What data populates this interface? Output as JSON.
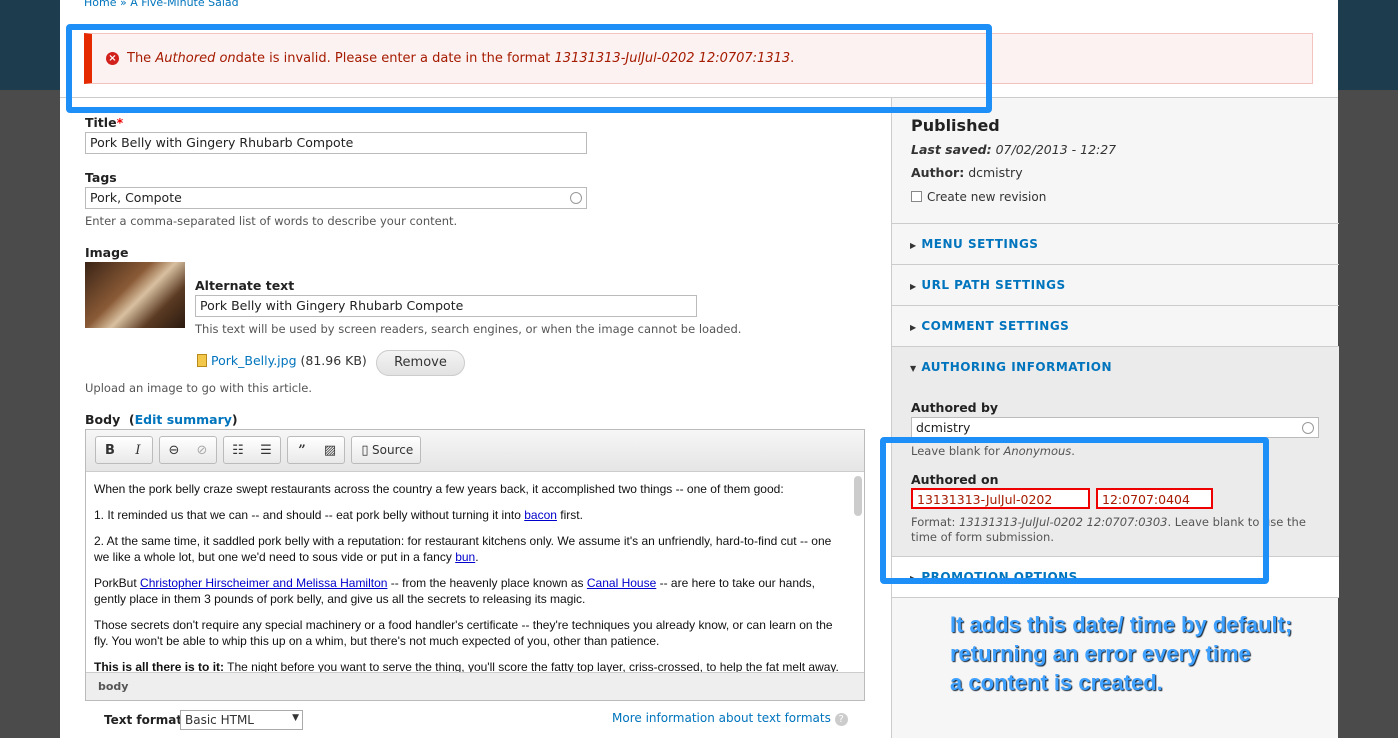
{
  "breadcrumb": {
    "home": "Home",
    "sep": "»",
    "current": "A Five-Minute Salad"
  },
  "error": {
    "pre": "The ",
    "field": "Authored on",
    "mid": " date is invalid. Please enter a date in the format ",
    "format": "13131313-JulJul-0202 12:0707:1313",
    "end": "."
  },
  "form": {
    "title_label": "Title",
    "required": "*",
    "title_value": "Pork Belly with Gingery Rhubarb Compote",
    "tags_label": "Tags",
    "tags_value": "Pork, Compote",
    "tags_desc": "Enter a comma-separated list of words to describe your content.",
    "image_label": "Image",
    "alt_label": "Alternate text",
    "alt_value": "Pork Belly with Gingery Rhubarb Compote",
    "alt_desc": "This text will be used by screen readers, search engines, or when the image cannot be loaded.",
    "file_name": "Pork_Belly.jpg",
    "file_size": "(81.96 KB)",
    "remove": "Remove",
    "image_desc": "Upload an image to go with this article.",
    "body_label": "Body",
    "edit_summary": "Edit summary",
    "toolbar": {
      "bold": "B",
      "italic": "I",
      "source": "Source"
    },
    "body_paragraphs": {
      "p1": "When the pork belly craze swept restaurants across the country a few years back, it accomplished two things -- one of them good:",
      "p2a": "1. It reminded us that we can -- and should -- eat pork belly without turning it into ",
      "p2link": "bacon",
      "p2b": " first.",
      "p3a": "2. At the same time, it saddled pork belly with a reputation: for restaurant kitchens only. We assume it's an unfriendly, hard-to-find cut -- one we like a whole lot, but one we'd need to sous vide or put in a fancy ",
      "p3link": "bun",
      "p3b": ".",
      "p4a": "PorkBut ",
      "p4link1": "Christopher Hirscheimer and Melissa Hamilton",
      "p4b": " -- from the heavenly place known as ",
      "p4link2": "Canal House",
      "p4c": " -- are here to take our hands, gently place in them 3 pounds of pork belly, and give us all the secrets to releasing its magic.",
      "p5": "Those secrets don't require any special machinery or a food handler's certificate -- they're techniques you already know, or can learn on the fly. You won't be able to whip this up on a whim, but there's not much expected of you, other than patience.",
      "p6bold": "This is all there is to it:",
      "p6": " The night before you want to serve the thing, you'll score the fatty top layer, criss-crossed, to help the fat melt away."
    },
    "editor_footer": "body",
    "text_format_label": "Text format",
    "text_format_value": "Basic HTML",
    "more_info": "More information about text formats"
  },
  "sidebar": {
    "status": "Published",
    "last_saved_label": "Last saved:",
    "last_saved": "07/02/2013 - 12:27",
    "author_label": "Author:",
    "author": "dcmistry",
    "revision": "Create new revision",
    "sections": [
      "MENU SETTINGS",
      "URL PATH SETTINGS",
      "COMMENT SETTINGS",
      "AUTHORING INFORMATION",
      "PROMOTION OPTIONS"
    ],
    "authored_by_label": "Authored by",
    "authored_by": "dcmistry",
    "anon_pre": "Leave blank for ",
    "anon": "Anonymous",
    "anon_end": ".",
    "authored_on_label": "Authored on",
    "date_value": "13131313-JulJul-0202",
    "time_value": "12:0707:0404",
    "format_pre": "Format: ",
    "format_value": "13131313-JulJul-0202 12:0707:0303",
    "format_post": ". Leave blank to use the time of form submission."
  },
  "annotation": {
    "line1": "It adds this date/ time by default;",
    "line2": "returning an error every time",
    "line3": "a content is created."
  },
  "colors": {
    "highlight": "#1e8ff7",
    "error": "#e52a00",
    "link": "#0074bd"
  }
}
